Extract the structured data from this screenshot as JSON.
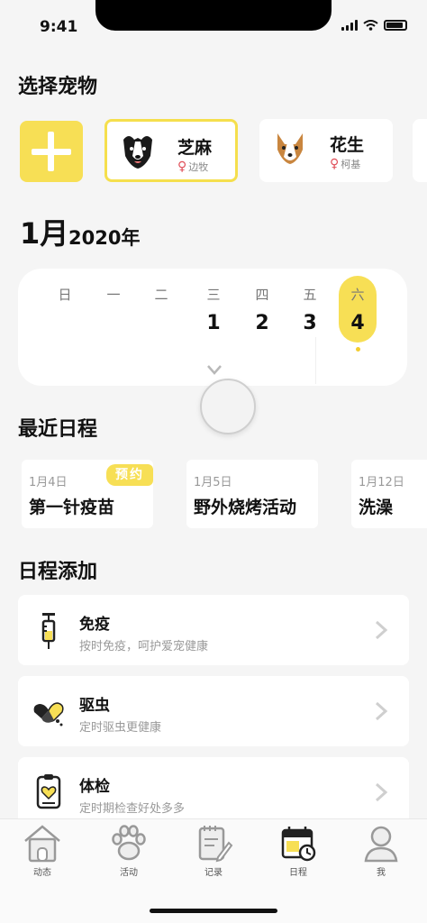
{
  "status_bar": {
    "time": "9:41"
  },
  "pet_section": {
    "title": "选择宠物",
    "pets": [
      {
        "name": "芝麻",
        "breed": "边牧",
        "gender": "♀"
      },
      {
        "name": "花生",
        "breed": "柯基",
        "gender": "♀"
      }
    ]
  },
  "calendar": {
    "month": "1月",
    "year": "2020年",
    "weekdays": [
      "日",
      "一",
      "二",
      "三",
      "四",
      "五",
      "六"
    ],
    "days": [
      "1",
      "2",
      "3",
      "4"
    ],
    "selected_day": "4"
  },
  "recent": {
    "title": "最近日程",
    "items": [
      {
        "date": "1月4日",
        "title": "第一针疫苗",
        "badge": "预约"
      },
      {
        "date": "1月5日",
        "title": "野外烧烤活动"
      },
      {
        "date": "1月12日",
        "title": "洗澡"
      }
    ]
  },
  "add_schedule": {
    "title": "日程添加",
    "items": [
      {
        "title": "免疫",
        "subtitle": "按时免疫，呵护爱宠健康",
        "icon": "syringe-icon"
      },
      {
        "title": "驱虫",
        "subtitle": "定时驱虫更健康",
        "icon": "pill-icon"
      },
      {
        "title": "体检",
        "subtitle": "定时期检查好处多多",
        "icon": "clipboard-heart-icon"
      }
    ]
  },
  "tab_bar": {
    "tabs": [
      {
        "label": "动态",
        "icon": "home-icon"
      },
      {
        "label": "活动",
        "icon": "paw-icon"
      },
      {
        "label": "记录",
        "icon": "notepad-icon"
      },
      {
        "label": "日程",
        "icon": "calendar-icon",
        "active": true
      },
      {
        "label": "我",
        "icon": "profile-icon"
      }
    ]
  },
  "colors": {
    "accent": "#f7df55",
    "female": "#e0505a"
  }
}
